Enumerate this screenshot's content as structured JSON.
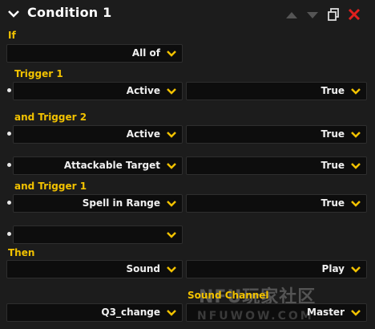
{
  "header": {
    "title": "Condition 1",
    "icons": [
      "chevron-down-icon",
      "move-up-icon",
      "move-down-icon",
      "duplicate-icon",
      "delete-icon"
    ],
    "colors": {
      "accent": "#f2c200",
      "delete": "#e0201e",
      "disabled_arrow": "#555555"
    }
  },
  "if_section": {
    "label": "If",
    "combinator": {
      "value": "All of"
    }
  },
  "checks": [
    {
      "label": "Trigger 1",
      "left": "Active",
      "right": "True"
    },
    {
      "label": "and Trigger 2",
      "left": "Active",
      "right": "True"
    },
    {
      "label": "",
      "left": "Attackable Target",
      "right": "True"
    },
    {
      "label": "and Trigger 1",
      "left": "Spell in Range",
      "right": "True"
    },
    {
      "label": "",
      "left": "",
      "right": null
    }
  ],
  "then_section": {
    "label": "Then",
    "action": {
      "left": "Sound",
      "right": "Play"
    },
    "sound_channel_label": "Sound Channel",
    "sound": {
      "left": "Q3_change",
      "right": "Master"
    }
  },
  "watermark": {
    "line1": "NFU玩家社区",
    "line2": "NFUWOW.COM"
  }
}
